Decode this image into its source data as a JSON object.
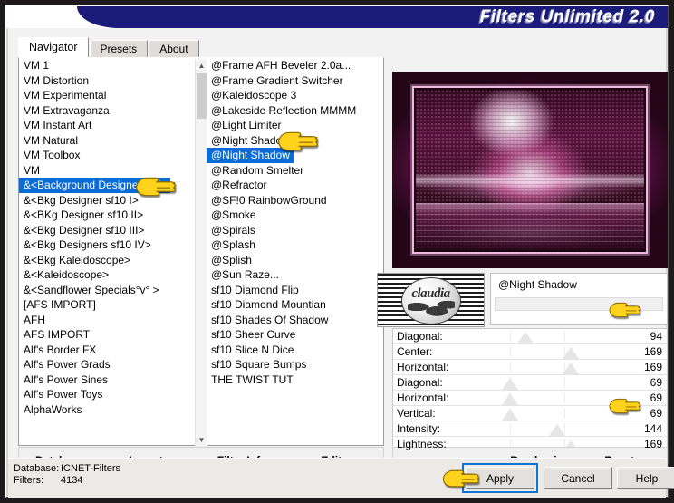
{
  "window": {
    "title": "Filters Unlimited 2.0"
  },
  "tabs": [
    {
      "label": "Navigator",
      "active": true
    },
    {
      "label": "Presets",
      "active": false
    },
    {
      "label": "About",
      "active": false
    }
  ],
  "categories": [
    "VM 1",
    "VM Distortion",
    "VM Experimental",
    "VM Extravaganza",
    "VM Instant Art",
    "VM Natural",
    "VM Toolbox",
    "VM",
    "&<Background Designers IV>",
    "&<Bkg Designer sf10 I>",
    "&<BKg Designer sf10 II>",
    "&<Bkg Designer sf10 III>",
    "&<Bkg Designers sf10 IV>",
    "&<Bkg Kaleidoscope>",
    "&<Kaleidoscope>",
    "&<Sandflower Specials°v° >",
    "[AFS IMPORT]",
    "AFH",
    "AFS IMPORT",
    "Alf's Border FX",
    "Alf's Power Grads",
    "Alf's Power Sines",
    "Alf's Power Toys",
    "AlphaWorks"
  ],
  "selected_category": "&<Background Designers IV>",
  "filters": [
    "@Frame AFH Beveler 2.0a...",
    "@Frame Gradient Switcher",
    "@Kaleidoscope 3",
    "@Lakeside Reflection MMMM",
    "@Light Limiter",
    "@Night Shadow Pool",
    "@Night Shadow",
    "@Random Smelter",
    "@Refractor",
    "@SF!0 RainbowGround",
    "@Smoke",
    "@Spirals",
    "@Splash",
    "@Splish",
    "@Sun Raze...",
    "sf10 Diamond Flip",
    "sf10 Diamond Mountian",
    "sf10 Shades Of Shadow",
    "sf10 Sheer Curve",
    "sf10 Slice N Dice",
    "sf10 Square Bumps",
    "THE TWIST TUT"
  ],
  "selected_filter": "@Night Shadow",
  "thumbnail": {
    "word": "claudia"
  },
  "current_filter_name": "@Night Shadow",
  "sliders": [
    {
      "label": "Diagonal:",
      "value": "94",
      "pct": 35
    },
    {
      "label": "Center:",
      "value": "169",
      "pct": 64
    },
    {
      "label": "Horizontal:",
      "value": "169",
      "pct": 64
    },
    {
      "label": "Diagonal:",
      "value": "69",
      "pct": 25
    },
    {
      "label": "Horizontal:",
      "value": "69",
      "pct": 25
    },
    {
      "label": "Vertical:",
      "value": "69",
      "pct": 25
    },
    {
      "label": "Intensity:",
      "value": "144",
      "pct": 55
    },
    {
      "label": "Lightness:",
      "value": "169",
      "pct": 64
    }
  ],
  "left_links": [
    {
      "pre": "",
      "key": "D",
      "post": "atabase"
    },
    {
      "pre": "I",
      "key": "m",
      "post": "port..."
    },
    {
      "pre": "Filter ",
      "key": "I",
      "post": "nfo..."
    },
    {
      "pre": "",
      "key": "E",
      "post": "ditor..."
    }
  ],
  "right_links": [
    {
      "label": "Randomize"
    },
    {
      "label": "Reset"
    }
  ],
  "status": {
    "database_key": "Database:",
    "database_value": "ICNET-Filters",
    "filters_key": "Filters:",
    "filters_value": "4134"
  },
  "buttons": {
    "apply": "Apply",
    "cancel": "Cancel",
    "help": "Help"
  },
  "colors": {
    "title_bg": "#1b1b7a",
    "selection": "#0a6cd6",
    "focus": "#1073d6",
    "hand": "#ffd21e"
  }
}
